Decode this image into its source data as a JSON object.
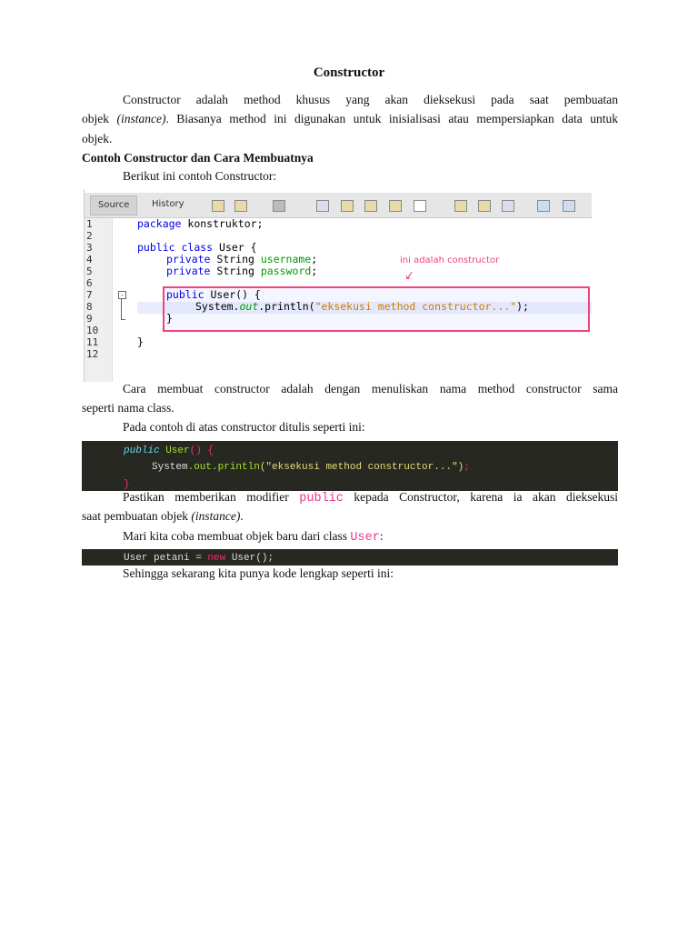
{
  "title": "Constructor",
  "para1": {
    "l1": "Constructor adalah method khusus yang akan dieksekusi pada saat pembuatan",
    "l2a": "objek ",
    "l2b": "(instance)",
    "l2c": ". Biasanya method ini digunakan untuk inisialisasi atau mempersiapkan data untuk",
    "l3": "objek."
  },
  "subheading": "Contoh Constructor dan Cara Membuatnya",
  "intro": "Berikut ini contoh Constructor:",
  "ide": {
    "tabs": [
      "Source",
      "History"
    ],
    "line_numbers": [
      "1",
      "2",
      "3",
      "4",
      "5",
      "6",
      "7",
      "8",
      "9",
      "10",
      "11",
      "12"
    ],
    "code": {
      "package_kw": "package",
      "package_name": " konstruktor;",
      "public": "public",
      "class": " class",
      "user_brace": " User {",
      "private": "private",
      "string": " String ",
      "username": "username",
      "password": "password",
      "semi": ";",
      "user_ctor": " User() {",
      "system": "System.",
      "out": "out",
      "println": ".println(",
      "str": "\"eksekusi method constructor...\"",
      "end": ");",
      "close": "}"
    },
    "annotation": "ini adalah constructor"
  },
  "para2": {
    "l1": "Cara membuat constructor adalah dengan menuliskan nama method constructor sama",
    "l2": "seperti nama class."
  },
  "para3": "Pada contoh di atas constructor ditulis seperti ini:",
  "snippet1": {
    "public": "public",
    "user": " User",
    "paren": "() {",
    "system": "System",
    "out": ".out.println",
    "args": "(\"eksekusi method constructor...\")",
    "semi": ";",
    "close": "}"
  },
  "para4": {
    "a": "Pastikan memberikan modifier ",
    "code": "public",
    "b": " kepada Constructor, karena ia akan dieksekusi",
    "l2a": "saat pembuatan objek ",
    "l2b": "(instance)",
    "l2c": "."
  },
  "para5": {
    "a": "Mari kita coba membuat objek baru dari class ",
    "code": "User",
    "b": ":"
  },
  "snippet2": {
    "a": "User petani = ",
    "new": "new",
    "b": " User();"
  },
  "para6": "Sehingga sekarang kita punya kode lengkap seperti ini:",
  "colors": {
    "accent": "#f0437d",
    "code_bg": "#272822"
  }
}
